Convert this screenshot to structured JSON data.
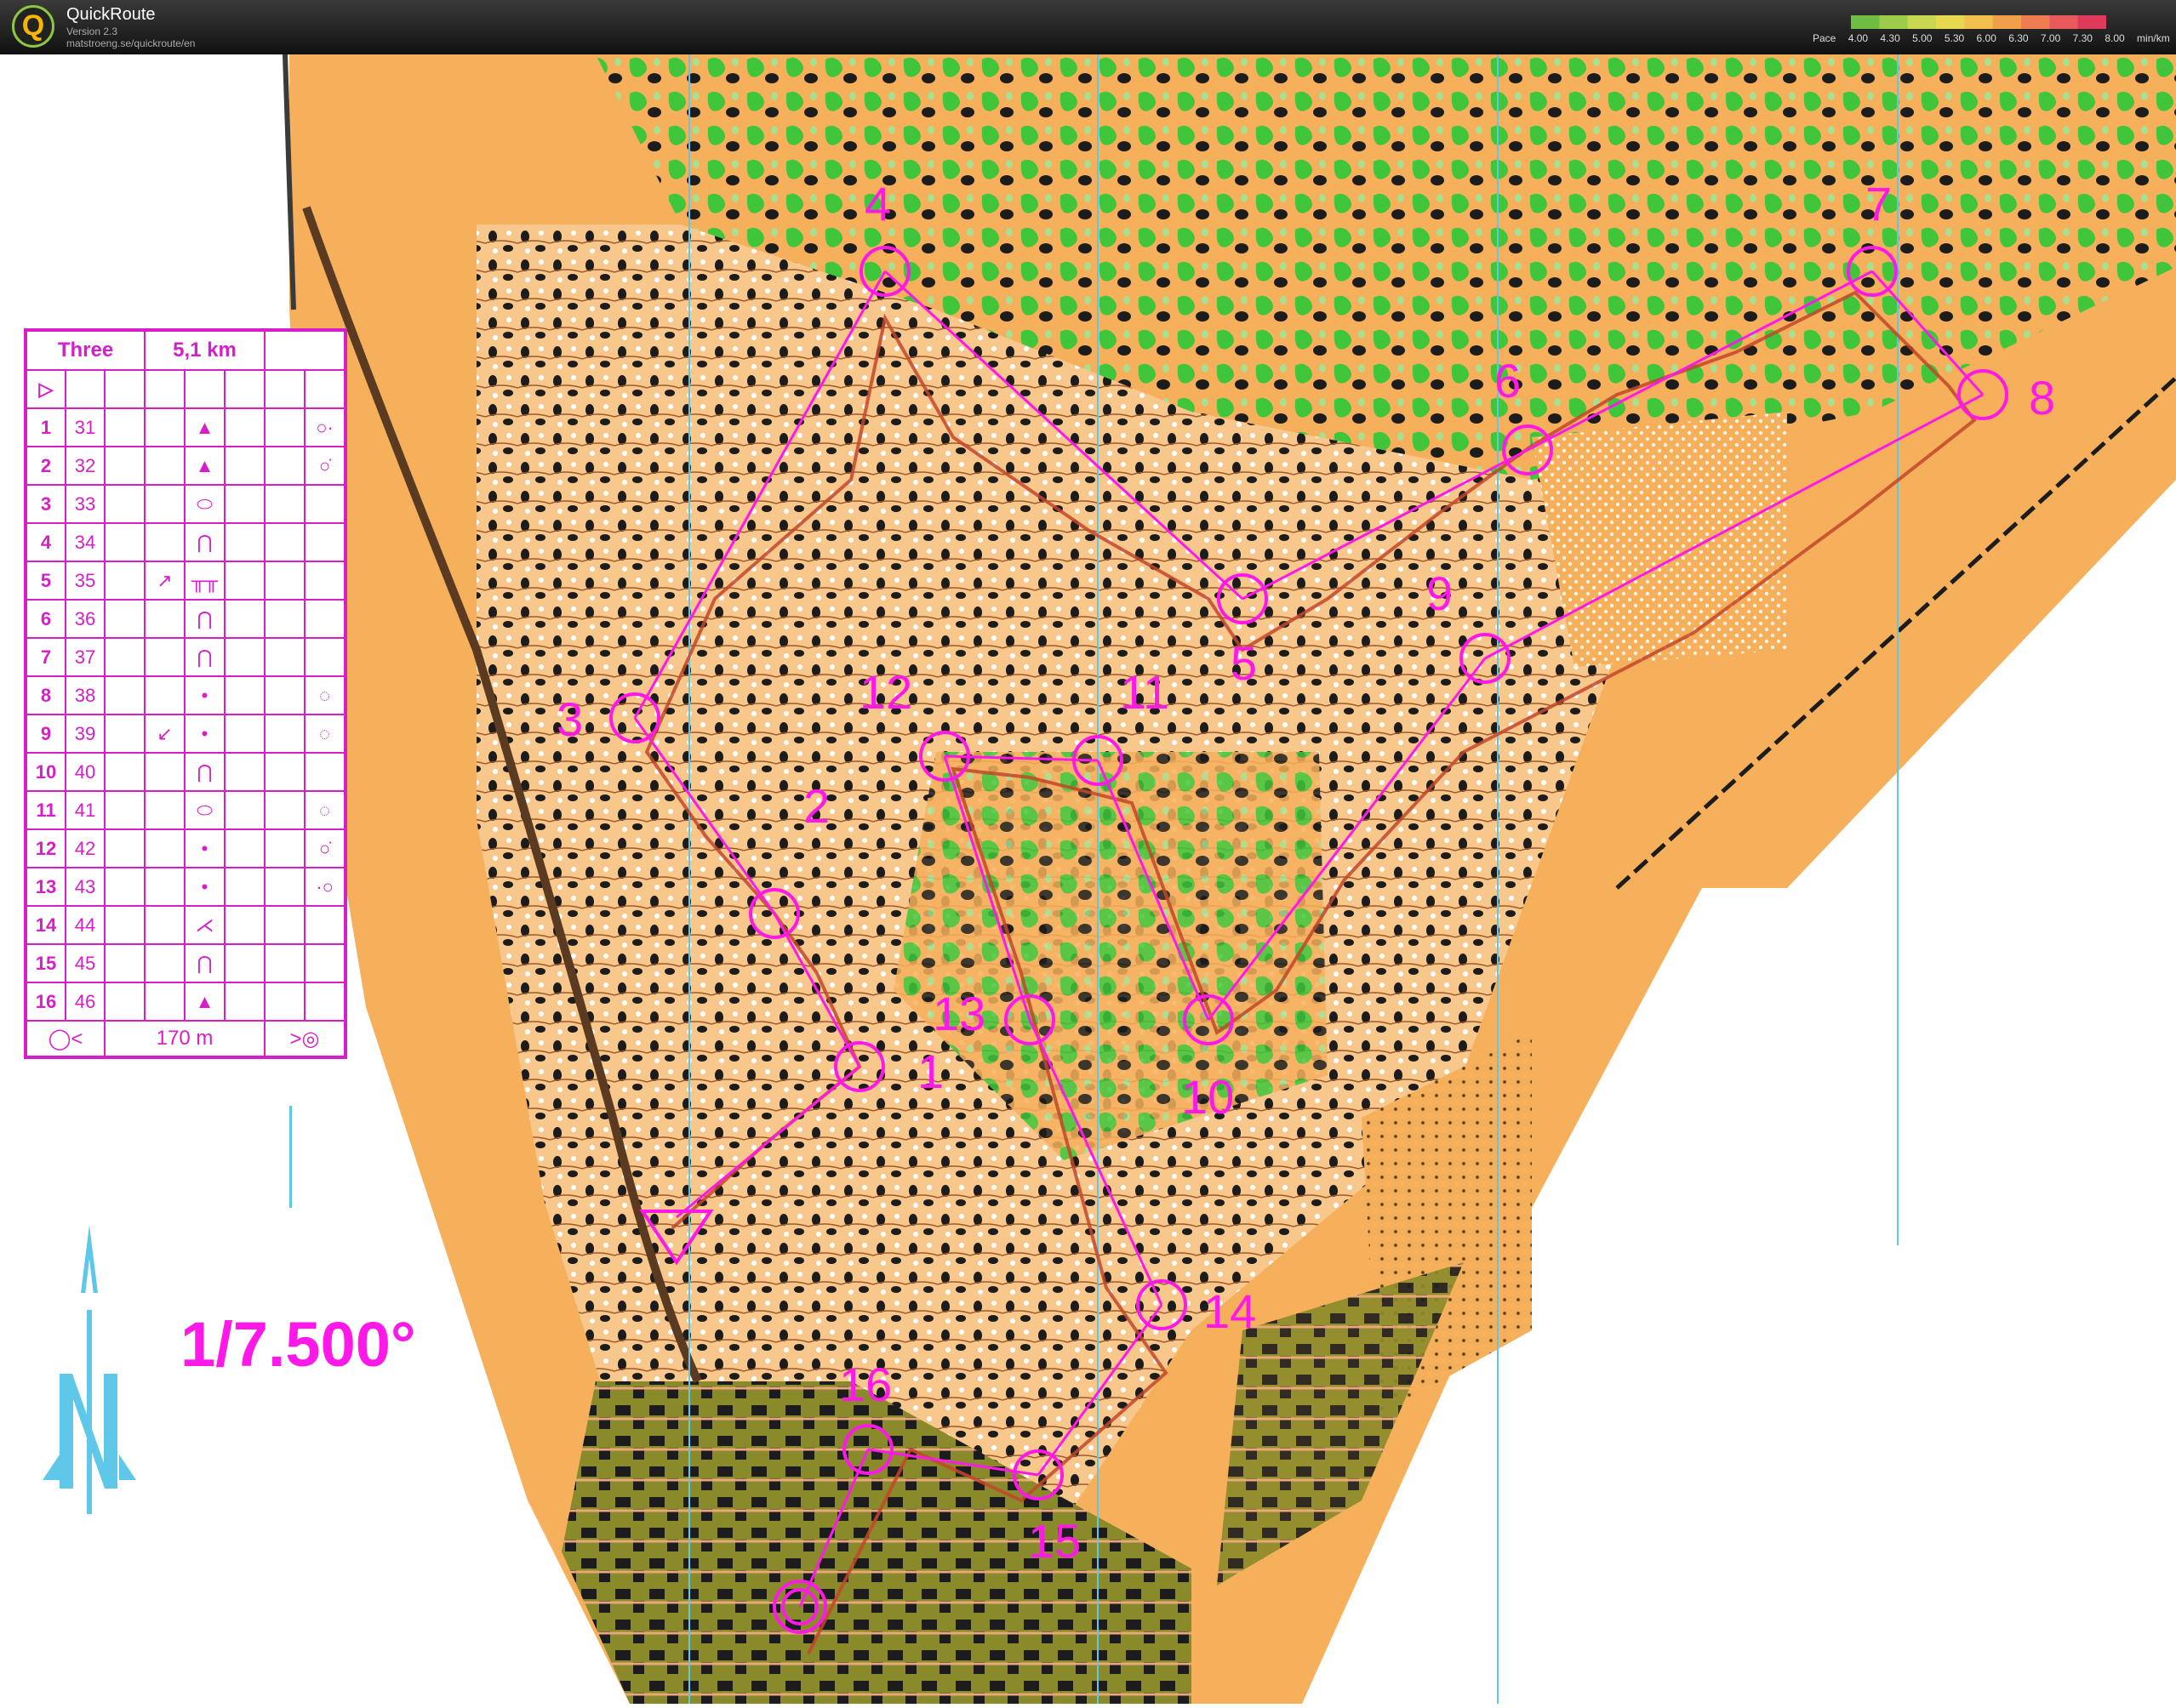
{
  "titlebar": {
    "app_name": "QuickRoute",
    "version": "Version 2.3",
    "url": "matstroeng.se/quickroute/en",
    "logo_letter": "Q",
    "pace_label": "Pace",
    "pace_ticks": [
      "4.00",
      "4.30",
      "5.00",
      "5.30",
      "6.00",
      "6.30",
      "7.00",
      "7.30",
      "8.00"
    ],
    "pace_unit": "min/km",
    "pace_colors": [
      "#6ebe44",
      "#9ccc4a",
      "#c8d650",
      "#e8d84f",
      "#f2c04d",
      "#f0a04a",
      "#ee7d52",
      "#e85a5a",
      "#e03a5a"
    ]
  },
  "map": {
    "colors": {
      "open_land": "#f6b05c",
      "rough_open": "#fde3c2",
      "forest_green": "#3fc63a",
      "light_green": "#a8e08f",
      "buildings": "#1c1c1c",
      "olive": "#8a8a2a",
      "course": "#ff19e8",
      "route": "#c2462a"
    },
    "scale_text": "1/7.500°",
    "controls": [
      {
        "label": "1"
      },
      {
        "label": "2"
      },
      {
        "label": "3"
      },
      {
        "label": "4"
      },
      {
        "label": "5"
      },
      {
        "label": "6"
      },
      {
        "label": "7"
      },
      {
        "label": "8"
      },
      {
        "label": "9"
      },
      {
        "label": "10"
      },
      {
        "label": "11"
      },
      {
        "label": "12"
      },
      {
        "label": "13"
      },
      {
        "label": "14"
      },
      {
        "label": "15"
      },
      {
        "label": "16"
      }
    ]
  },
  "description_sheet": {
    "course_name": "Three",
    "length": "5,1 km",
    "finish_distance": "170 m",
    "rows": [
      {
        "num": "1",
        "code": "31",
        "dir": "",
        "feature": "▲",
        "extra": "○·"
      },
      {
        "num": "2",
        "code": "32",
        "dir": "",
        "feature": "▲",
        "extra": "○̇"
      },
      {
        "num": "3",
        "code": "33",
        "dir": "",
        "feature": "⬭",
        "extra": ""
      },
      {
        "num": "4",
        "code": "34",
        "dir": "",
        "feature": "⋂",
        "extra": ""
      },
      {
        "num": "5",
        "code": "35",
        "dir": "↗",
        "feature": "╥╥",
        "extra": ""
      },
      {
        "num": "6",
        "code": "36",
        "dir": "",
        "feature": "⋂",
        "extra": ""
      },
      {
        "num": "7",
        "code": "37",
        "dir": "",
        "feature": "⋂",
        "extra": ""
      },
      {
        "num": "8",
        "code": "38",
        "dir": "",
        "feature": "•",
        "extra": "◌"
      },
      {
        "num": "9",
        "code": "39",
        "dir": "↙",
        "feature": "•",
        "extra": "◌"
      },
      {
        "num": "10",
        "code": "40",
        "dir": "",
        "feature": "⋂",
        "extra": ""
      },
      {
        "num": "11",
        "code": "41",
        "dir": "",
        "feature": "⬭",
        "extra": "◌"
      },
      {
        "num": "12",
        "code": "42",
        "dir": "",
        "feature": "•",
        "extra": "○̇"
      },
      {
        "num": "13",
        "code": "43",
        "dir": "",
        "feature": "•",
        "extra": "·○"
      },
      {
        "num": "14",
        "code": "44",
        "dir": "",
        "feature": "⋌",
        "extra": ""
      },
      {
        "num": "15",
        "code": "45",
        "dir": "",
        "feature": "⋂",
        "extra": ""
      },
      {
        "num": "16",
        "code": "46",
        "dir": "",
        "feature": "▲",
        "extra": ""
      }
    ]
  }
}
